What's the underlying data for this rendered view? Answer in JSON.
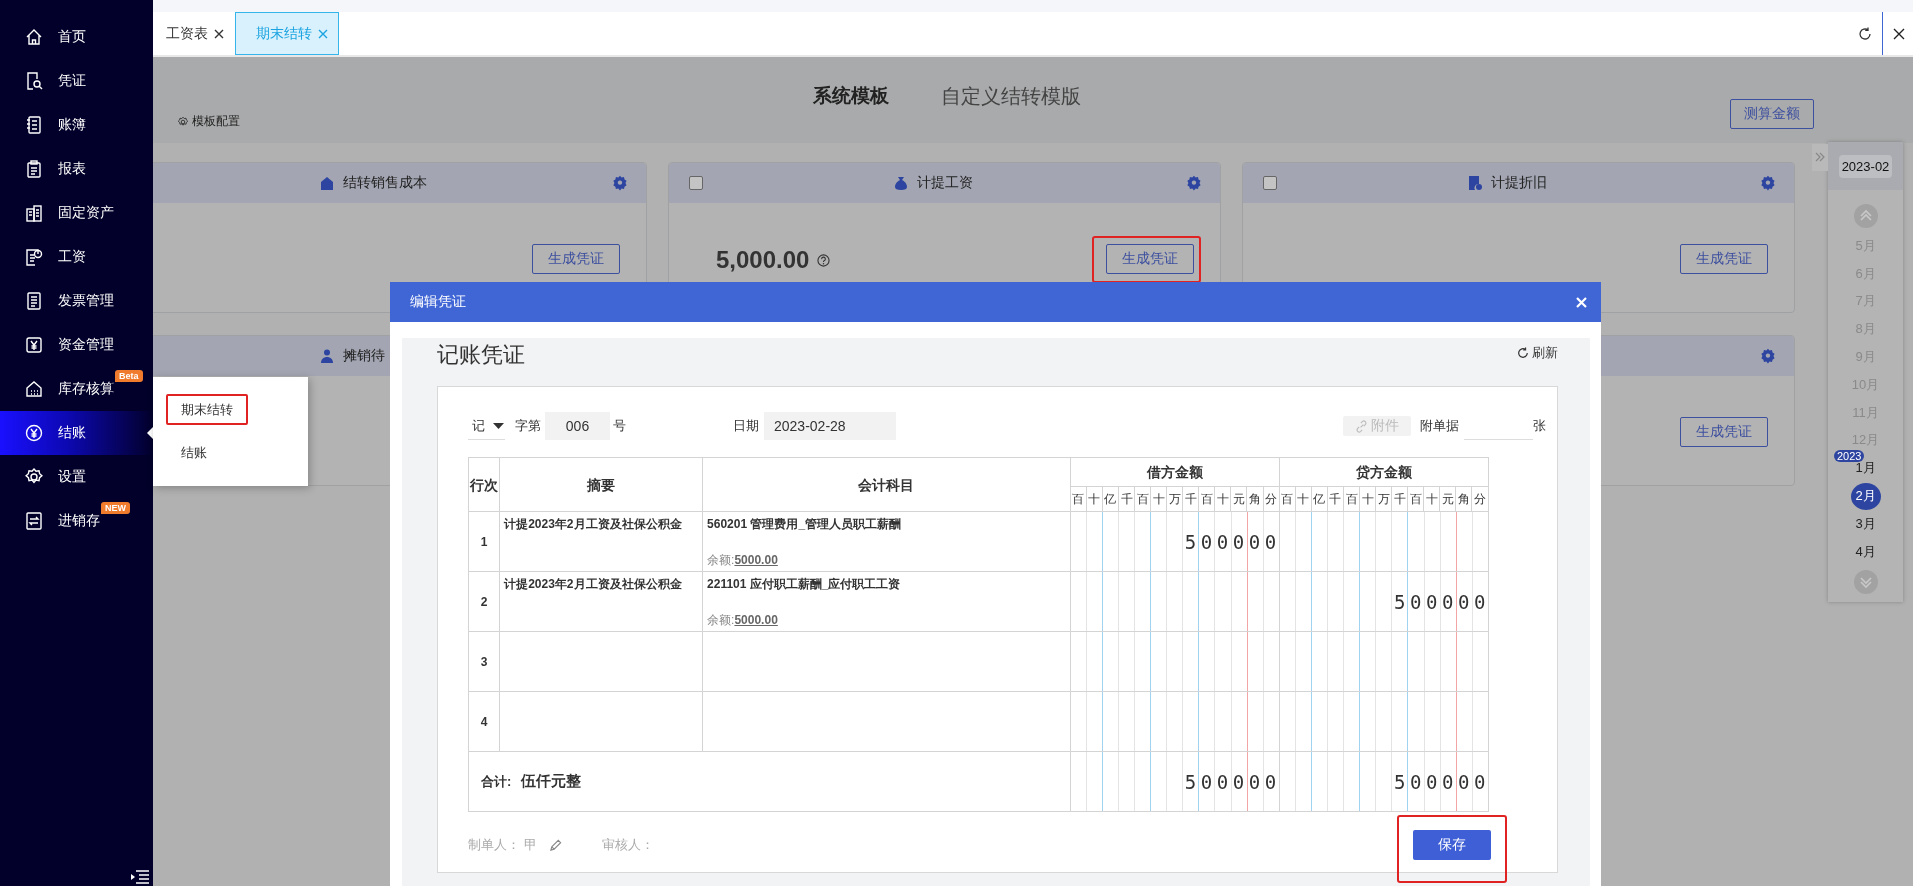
{
  "tabs": [
    {
      "label": "工资表",
      "selected": false
    },
    {
      "label": "期末结转",
      "selected": true
    }
  ],
  "sidebar": {
    "items": [
      {
        "label": "首页",
        "selected": false
      },
      {
        "label": "凭证",
        "selected": false
      },
      {
        "label": "账簿",
        "selected": false
      },
      {
        "label": "报表",
        "selected": false
      },
      {
        "label": "固定资产",
        "selected": false
      },
      {
        "label": "工资",
        "selected": false
      },
      {
        "label": "发票管理",
        "selected": false
      },
      {
        "label": "资金管理",
        "selected": false
      },
      {
        "label": "库存核算",
        "selected": false,
        "badge": "Beta"
      },
      {
        "label": "结账",
        "selected": true
      },
      {
        "label": "设置",
        "selected": false
      },
      {
        "label": "进销存",
        "selected": false,
        "badge": "NEW"
      }
    ]
  },
  "submenu": {
    "items": [
      {
        "label": "期末结转",
        "highlighted": true
      },
      {
        "label": "结账",
        "highlighted": false
      }
    ]
  },
  "template_config": "模板配置",
  "template_tabs": [
    {
      "label": "系统模板",
      "selected": true
    },
    {
      "label": "自定义结转模版",
      "selected": false
    }
  ],
  "estimate_button": "测算金额",
  "cards": [
    [
      {
        "title": "结转销售成本",
        "button": "生成凭证",
        "button_highlighted": false
      },
      {
        "title": "计提工资",
        "checked": false,
        "amount": "5,000.00",
        "button": "生成凭证",
        "button_highlighted": true
      },
      {
        "title": "计提折旧",
        "checked": false,
        "button": "生成凭证",
        "button_highlighted": false
      }
    ],
    [
      {
        "title": "摊销待"
      },
      {
        "button": "生成凭证",
        "button_highlighted": false
      }
    ]
  ],
  "calendar": {
    "current": "2023-02",
    "months": [
      {
        "label": "5月",
        "selected": false,
        "dimmed": true
      },
      {
        "label": "6月",
        "selected": false,
        "dimmed": true
      },
      {
        "label": "7月",
        "selected": false,
        "dimmed": true
      },
      {
        "label": "8月",
        "selected": false,
        "dimmed": true
      },
      {
        "label": "9月",
        "selected": false,
        "dimmed": true
      },
      {
        "label": "10月",
        "selected": false,
        "dimmed": true
      },
      {
        "label": "11月",
        "selected": false,
        "dimmed": true
      },
      {
        "label": "12月",
        "selected": false,
        "dimmed": true
      },
      {
        "label": "1月",
        "selected": false,
        "dimmed": false,
        "year_badge": "2023"
      },
      {
        "label": "2月",
        "selected": true,
        "dimmed": false
      },
      {
        "label": "3月",
        "selected": false,
        "dimmed": false
      },
      {
        "label": "4月",
        "selected": false,
        "dimmed": false
      }
    ]
  },
  "dialog": {
    "title": "编辑凭证",
    "voucher_title": "记账凭证",
    "refresh": "刷新",
    "voucher_type": "记",
    "number_prefix": "字第",
    "number": "006",
    "number_suffix": "号",
    "date_label": "日期",
    "date": "2023-02-28",
    "attach_button": "附件",
    "attach_disabled": true,
    "docs_label": "附单据",
    "docs_suffix": "张",
    "columns": {
      "no": "行次",
      "summary": "摘要",
      "account": "会计科目",
      "debit": "借方金额",
      "credit": "贷方金额"
    },
    "debit_units": [
      "百",
      "十",
      "亿",
      "千",
      "百",
      "十",
      "万",
      "千",
      "百",
      "十",
      "元",
      "角",
      "分"
    ],
    "credit_units": [
      "百",
      "十",
      "亿",
      "千",
      "百",
      "十",
      "万",
      "千",
      "百",
      "十",
      "元",
      "角",
      "分"
    ],
    "rows": [
      {
        "no": "1",
        "summary": "计提2023年2月工资及社保公积金",
        "account": "560201 管理费用_管理人员职工薪酬",
        "balance_label": "余额:",
        "balance": "5000.00",
        "debit": "500000"
      },
      {
        "no": "2",
        "summary": "计提2023年2月工资及社保公积金",
        "account": "221101 应付职工薪酬_应付职工工资",
        "balance_label": "余额:",
        "balance": "5000.00",
        "credit": "500000"
      },
      {
        "no": "3"
      },
      {
        "no": "4"
      }
    ],
    "total": {
      "label": "合计:",
      "words": "伍仟元整",
      "debit": "500000",
      "credit": "500000"
    },
    "maker_label": "制单人：",
    "maker": "甲",
    "reviewer_label": "审核人：",
    "save_button": "保存",
    "save_highlighted": true
  }
}
